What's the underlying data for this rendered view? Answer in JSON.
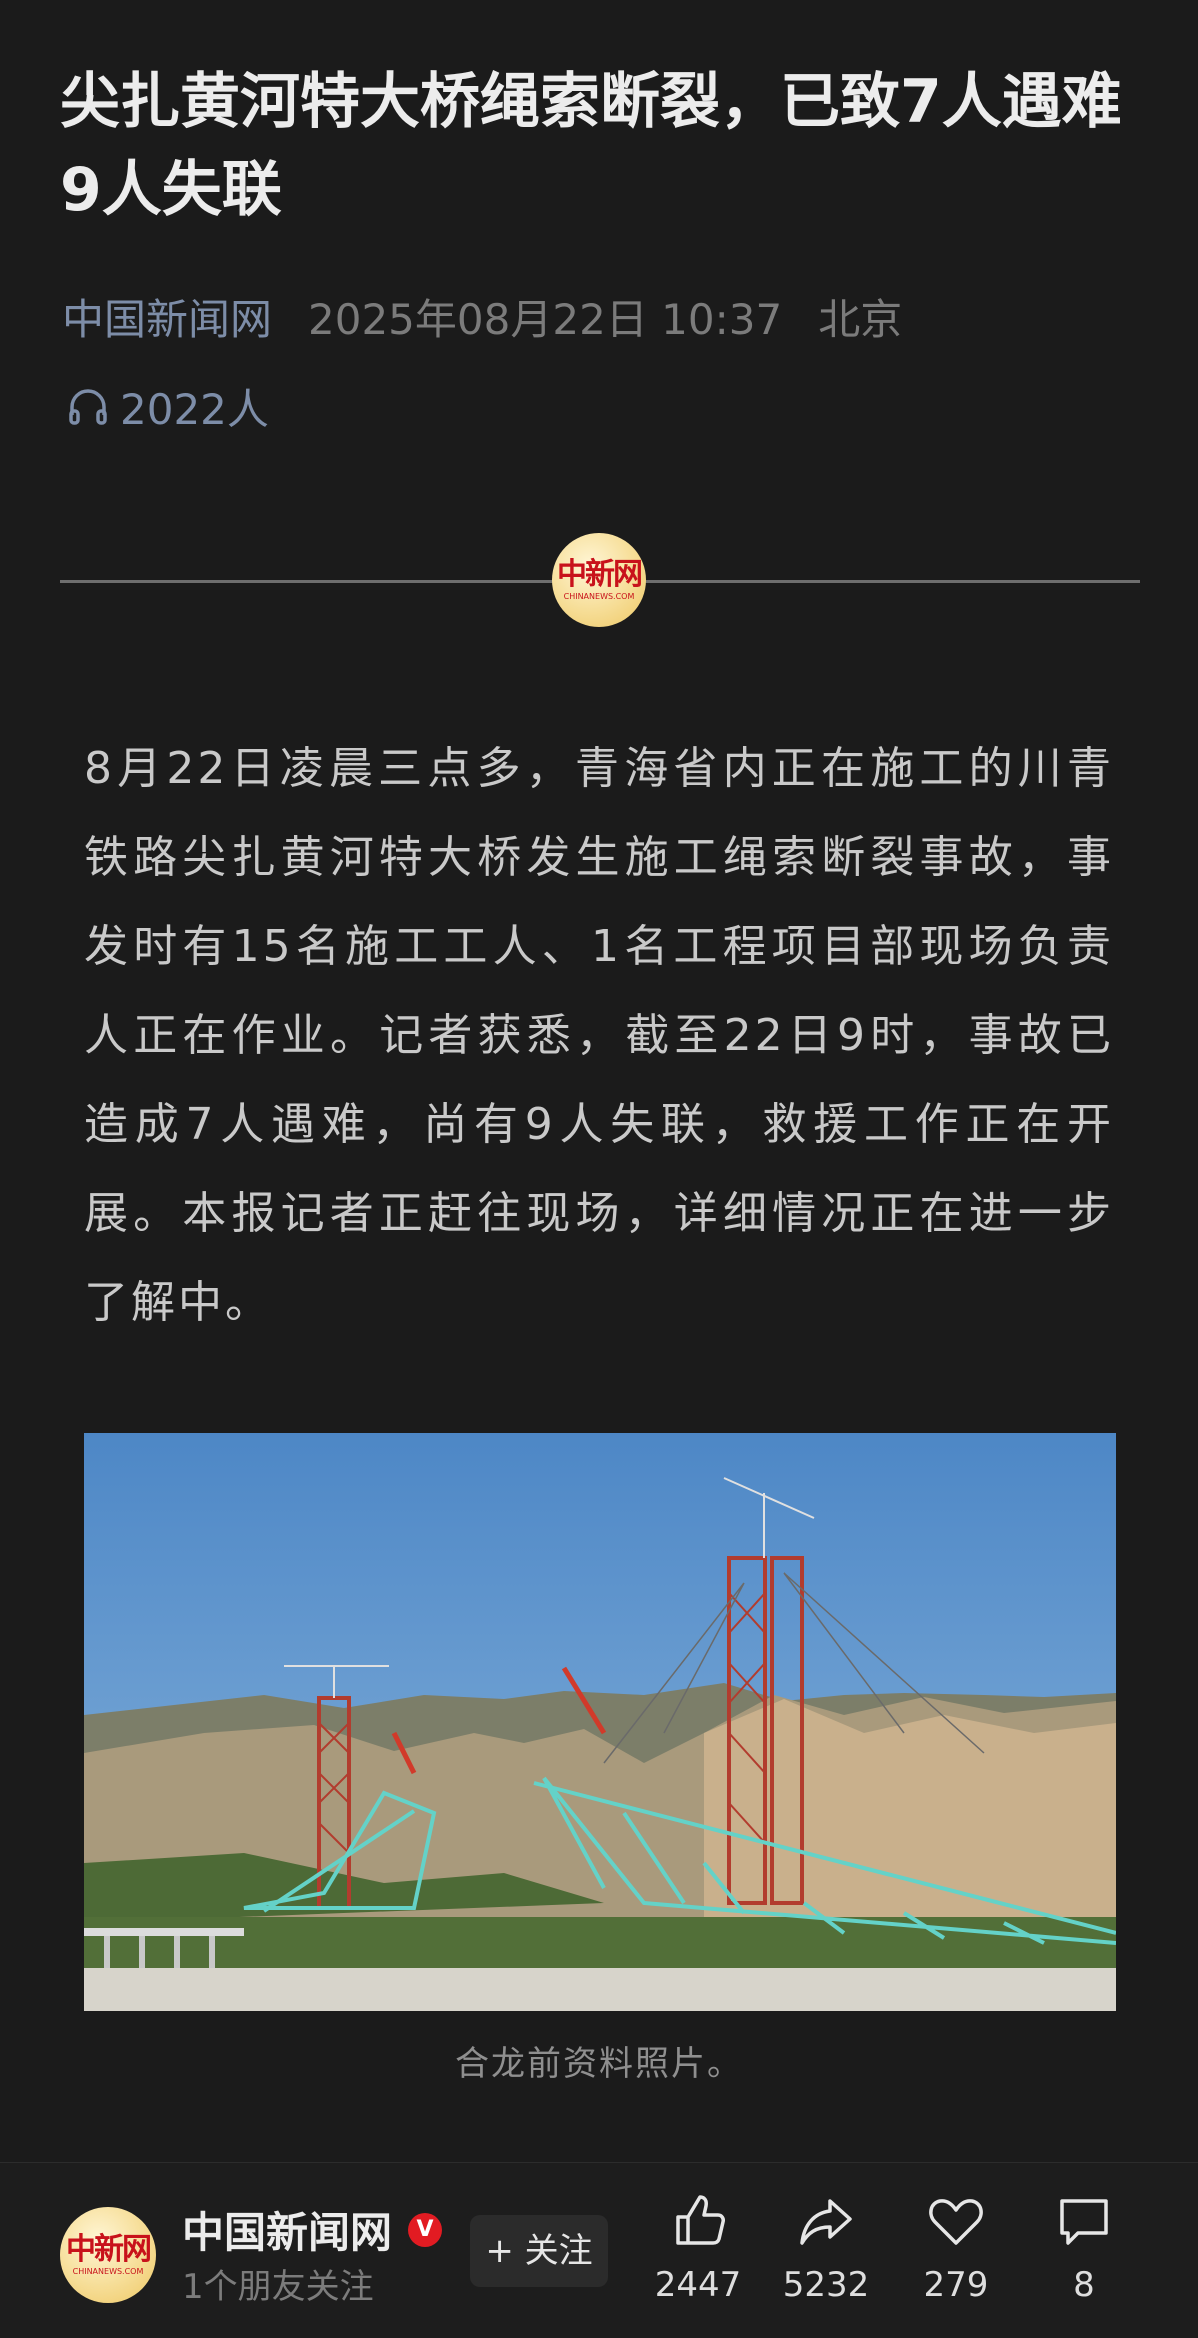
{
  "article": {
    "title": "尖扎黄河特大桥绳索断裂，已致7人遇难9人失联",
    "source": "中国新闻网",
    "datetime": "2025年08月22日 10:37",
    "location": "北京",
    "listeners": "2022人",
    "paragraph": "8月22日凌晨三点多，青海省内正在施工的川青铁路尖扎黄河特大桥发生施工绳索断裂事故，事发时有15名施工工人、1名工程项目部现场负责人正在作业。记者获悉，截至22日9时，事故已造成7人遇难，尚有9人失联，救援工作正在开展。本报记者正赶往现场，详细情况正在进一步了解中。",
    "photo_caption": "合龙前资料照片。",
    "divider_logo_cn": "中新网",
    "divider_logo_en": "CHINANEWS.COM"
  },
  "account": {
    "name": "中国新闻网",
    "verified_mark": "V",
    "friends_following": "1个朋友关注",
    "follow_label": "+ 关注",
    "avatar_cn": "中新网",
    "avatar_en": "CHINANEWS.COM"
  },
  "actions": {
    "like_count": "2447",
    "share_count": "5232",
    "favorite_count": "279",
    "comment_count": "8"
  },
  "icons": {
    "listen": "headphones-icon",
    "like": "thumbs-up-icon",
    "share": "share-arrow-icon",
    "favorite": "heart-icon",
    "comment": "comment-bubble-icon"
  },
  "colors": {
    "background": "#1b1b1b",
    "source_link": "#7d8da8",
    "verified_badge": "#e21b22",
    "logo_red": "#c8121b"
  }
}
